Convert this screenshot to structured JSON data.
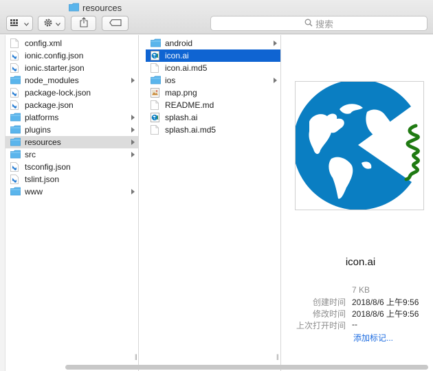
{
  "window": {
    "title": "resources"
  },
  "toolbar": {
    "search_placeholder": "搜索",
    "view_icon": "grid-view-icon",
    "action_icon": "gear-icon",
    "share_icon": "share-icon",
    "tag_icon": "tag-icon"
  },
  "column1": {
    "items": [
      {
        "label": "config.xml",
        "icon": "xml-file-icon"
      },
      {
        "label": "ionic.config.json",
        "icon": "vscode-file-icon"
      },
      {
        "label": "ionic.starter.json",
        "icon": "vscode-file-icon"
      },
      {
        "label": "node_modules",
        "icon": "folder-icon"
      },
      {
        "label": "package-lock.json",
        "icon": "vscode-file-icon"
      },
      {
        "label": "package.json",
        "icon": "vscode-file-icon"
      },
      {
        "label": "platforms",
        "icon": "folder-icon"
      },
      {
        "label": "plugins",
        "icon": "folder-icon"
      },
      {
        "label": "resources",
        "icon": "folder-icon"
      },
      {
        "label": "src",
        "icon": "folder-icon"
      },
      {
        "label": "tsconfig.json",
        "icon": "vscode-file-icon"
      },
      {
        "label": "tslint.json",
        "icon": "vscode-file-icon"
      },
      {
        "label": "www",
        "icon": "folder-icon"
      }
    ]
  },
  "column2": {
    "items": [
      {
        "label": "android",
        "icon": "folder-icon"
      },
      {
        "label": "icon.ai",
        "icon": "ai-file-icon"
      },
      {
        "label": "icon.ai.md5",
        "icon": "text-file-icon"
      },
      {
        "label": "ios",
        "icon": "folder-icon"
      },
      {
        "label": "map.png",
        "icon": "image-file-icon"
      },
      {
        "label": "README.md",
        "icon": "text-file-icon"
      },
      {
        "label": "splash.ai",
        "icon": "ai-file-icon"
      },
      {
        "label": "splash.ai.md5",
        "icon": "text-file-icon"
      }
    ]
  },
  "preview": {
    "name": "icon.ai",
    "size": "7 KB",
    "created_label": "创建时间",
    "created_value": "2018/8/6 上午9:56",
    "modified_label": "修改时间",
    "modified_value": "2018/8/6 上午9:56",
    "opened_label": "上次打开时间",
    "opened_value": "--",
    "add_tags": "添加标记..."
  },
  "colors": {
    "selection": "#0f64d2",
    "folder": "#5ab5ec",
    "globe": "#0a7ec2",
    "spring": "#1f7a12",
    "link": "#1a6ae0"
  }
}
